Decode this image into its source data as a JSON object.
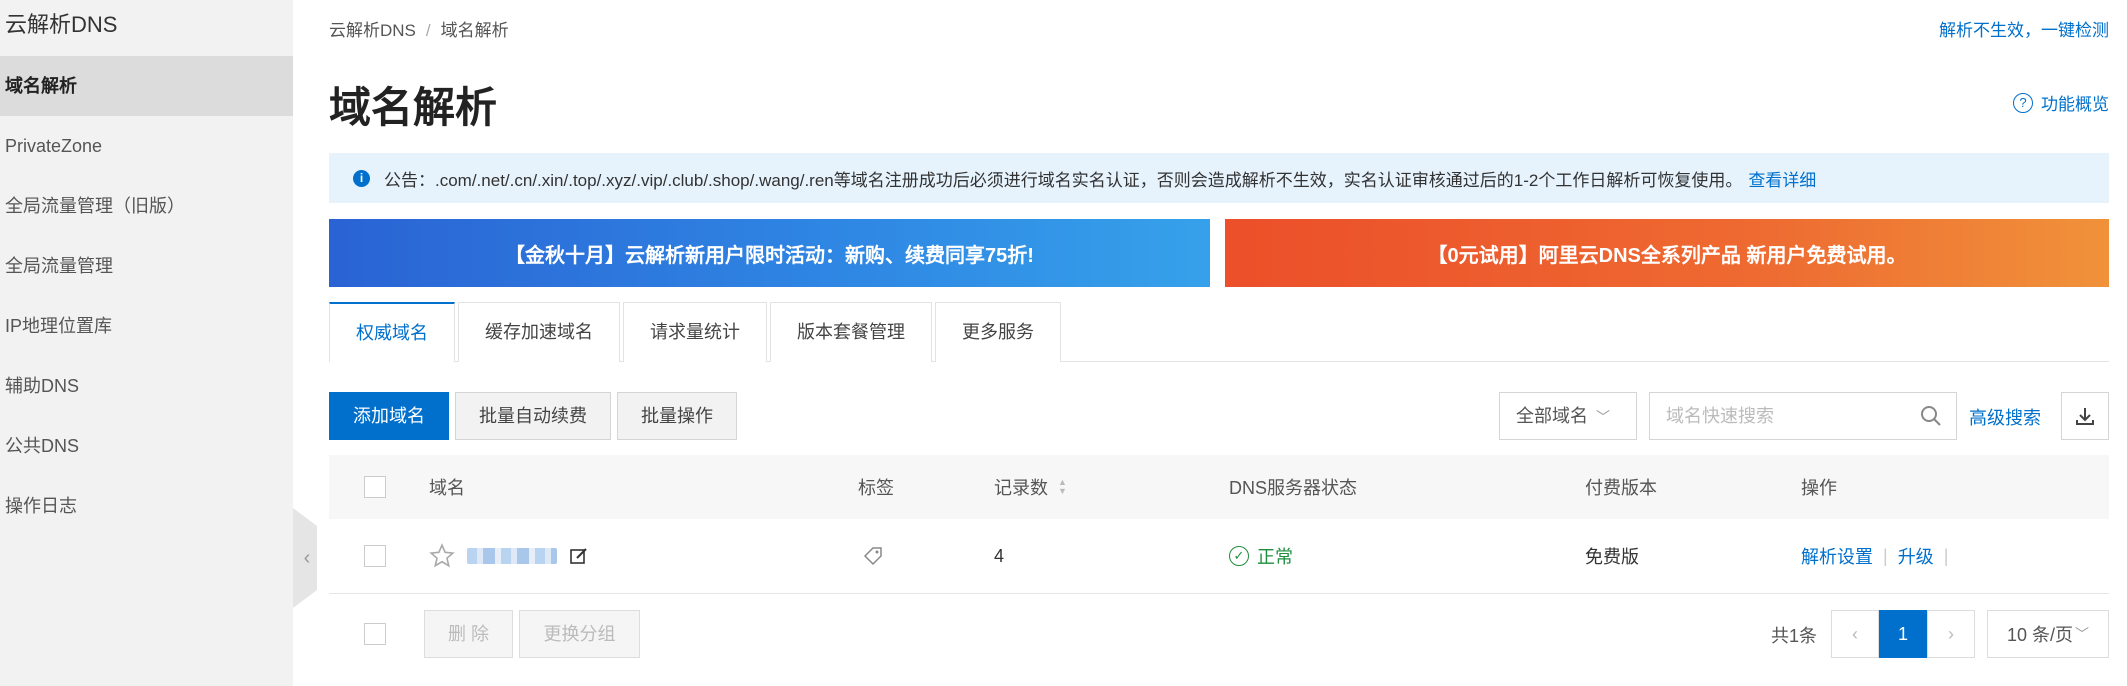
{
  "sidebar": {
    "title": "云解析DNS",
    "items": [
      {
        "label": "域名解析",
        "active": true
      },
      {
        "label": "PrivateZone"
      },
      {
        "label": "全局流量管理（旧版）"
      },
      {
        "label": "全局流量管理"
      },
      {
        "label": "IP地理位置库"
      },
      {
        "label": "辅助DNS"
      },
      {
        "label": "公共DNS"
      },
      {
        "label": "操作日志"
      }
    ]
  },
  "breadcrumb": {
    "root": "云解析DNS",
    "sep": "/",
    "current": "域名解析"
  },
  "header": {
    "top_link": "解析不生效，一键检测",
    "title": "域名解析",
    "overview_label": "功能概览"
  },
  "notice": {
    "text": "公告：.com/.net/.cn/.xin/.top/.xyz/.vip/.club/.shop/.wang/.ren等域名注册成功后必须进行域名实名认证，否则会造成解析不生效，实名认证审核通过后的1-2个工作日解析可恢复使用。",
    "link": "查看详细"
  },
  "banners": [
    {
      "text": "【金秋十月】云解析新用户限时活动：新购、续费同享75折!"
    },
    {
      "text": "【0元试用】阿里云DNS全系列产品 新用户免费试用。"
    }
  ],
  "tabs": [
    {
      "label": "权威域名",
      "active": true
    },
    {
      "label": "缓存加速域名"
    },
    {
      "label": "请求量统计"
    },
    {
      "label": "版本套餐管理"
    },
    {
      "label": "更多服务"
    }
  ],
  "toolbar": {
    "add": "添加域名",
    "batch_renew": "批量自动续费",
    "batch_ops": "批量操作",
    "filter_selected": "全部域名",
    "search_placeholder": "域名快速搜索",
    "advanced": "高级搜索"
  },
  "table": {
    "headers": {
      "domain": "域名",
      "tag": "标签",
      "records": "记录数",
      "dns_status": "DNS服务器状态",
      "edition": "付费版本",
      "actions": "操作"
    },
    "rows": [
      {
        "records": "4",
        "dns_status": "正常",
        "edition": "免费版",
        "action_settings": "解析设置",
        "action_upgrade": "升级"
      }
    ]
  },
  "footer": {
    "delete": "删 除",
    "change_group": "更换分组",
    "total": "共1条",
    "current_page": "1",
    "page_size": "10 条/页"
  },
  "colors": {
    "accent": "#0070cc",
    "ok": "#1e8e3e",
    "banner_blue": "#2a63d4",
    "banner_orange": "#ec4f2a"
  }
}
